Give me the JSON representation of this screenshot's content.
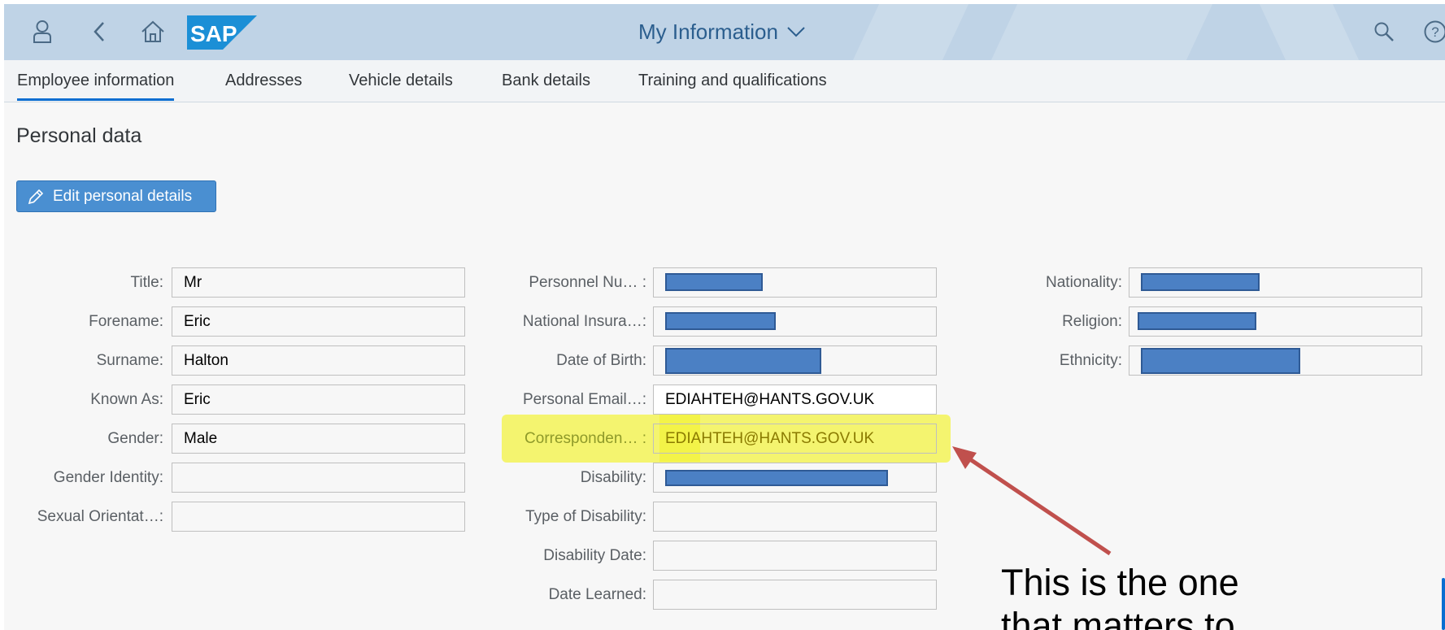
{
  "shell": {
    "logo_text": "SAP",
    "title": "My Information",
    "icons": [
      "user-icon",
      "back-icon",
      "home-icon",
      "search-icon",
      "help-icon"
    ],
    "colors": {
      "bar": "#bfd3e6",
      "title": "#2b5e8e",
      "logo": "#1b8fd6"
    }
  },
  "tabs": [
    {
      "label": "Employee information"
    },
    {
      "label": "Addresses"
    },
    {
      "label": "Vehicle details"
    },
    {
      "label": "Bank details"
    },
    {
      "label": "Training and qualifications"
    }
  ],
  "section": {
    "title": "Personal data"
  },
  "edit_button": {
    "label": "Edit personal details"
  },
  "col1": [
    {
      "label": "Title:",
      "value": "Mr"
    },
    {
      "label": "Forename:",
      "value": "Eric"
    },
    {
      "label": "Surname:",
      "value": "Halton"
    },
    {
      "label": "Known As:",
      "value": "Eric"
    },
    {
      "label": "Gender:",
      "value": "Male"
    },
    {
      "label": "Gender Identity:",
      "value": ""
    },
    {
      "label": "Sexual Orientat…:",
      "value": ""
    }
  ],
  "col2": [
    {
      "label": "Personnel Nu… :",
      "value": ""
    },
    {
      "label": "National Insura…:",
      "value": ""
    },
    {
      "label": "Date of Birth:",
      "value": ""
    },
    {
      "label": "Personal Email…:",
      "value": "EDIAHTEH@HANTS.GOV.UK"
    },
    {
      "label": "Corresponden… :",
      "value": "EDIAHTEH@HANTS.GOV.UK"
    },
    {
      "label": "Disability:",
      "value": ""
    },
    {
      "label": "Type of Disability:",
      "value": ""
    },
    {
      "label": "Disability Date:",
      "value": ""
    },
    {
      "label": "Date Learned:",
      "value": ""
    }
  ],
  "col3": [
    {
      "label": "Nationality:",
      "value": ""
    },
    {
      "label": "Religion:",
      "value": ""
    },
    {
      "label": "Ethnicity:",
      "value": ""
    }
  ],
  "annotation": {
    "line1": "This is the one",
    "line2": "that matters to",
    "highlight_color": "#f2f200",
    "arrow_color": "#c0504d"
  },
  "redaction_color": "#4b80c4"
}
